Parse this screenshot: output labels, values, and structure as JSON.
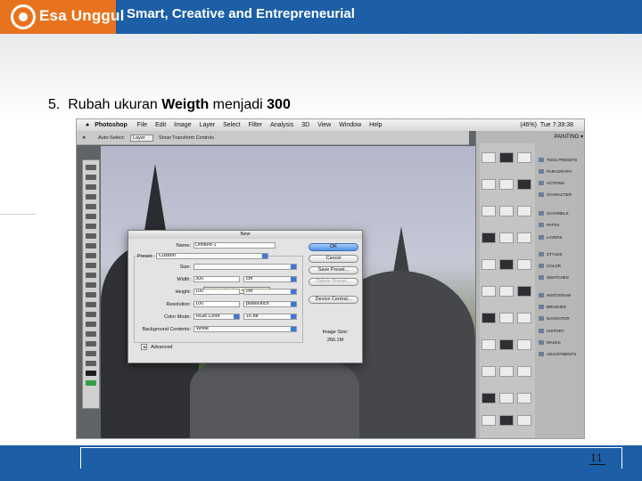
{
  "header": {
    "logo_text": "Esa Unggul",
    "tagline": "Smart, Creative and Entrepreneurial"
  },
  "step": {
    "number": "5.",
    "text_before": "Rubah ukuran ",
    "text_bold1": "Weigth",
    "text_middle": " menjadi ",
    "text_bold2": "300"
  },
  "photoshop": {
    "app": "Photoshop",
    "menus": [
      "File",
      "Edit",
      "Image",
      "Layer",
      "Select",
      "Filter",
      "Analysis",
      "3D",
      "View",
      "Window",
      "Help"
    ],
    "battery": "(46%)",
    "clock": "Tue 7:39:38",
    "workspace": "PAINTING ▾",
    "options": {
      "auto_select": "Auto-Select:",
      "layer": "Layer",
      "show_transform": "Show Transform Controls"
    },
    "panels": [
      "TOOL PRESETS",
      "PARAGRAPH",
      "ACTIONS",
      "CHARACTER",
      "CHANNELS",
      "PATHS",
      "LAYERS",
      "STYLES",
      "COLOR",
      "SWATCHES",
      "HISTOGRAM",
      "BRUSHES",
      "NAVIGATOR",
      "HISTORY",
      "MASKS",
      "ADJUSTMENTS"
    ]
  },
  "dialog": {
    "title": "New",
    "name_label": "Name:",
    "name_value": "Untitled-1",
    "preset_label": "Preset:",
    "preset_value": "Custom",
    "size_label": "Size:",
    "width_label": "Width:",
    "width_value": "300",
    "width_unit": "cm",
    "height_label": "Height:",
    "height_value": "100",
    "height_unit": "cm",
    "resolution_label": "Resolution:",
    "resolution_value": "100",
    "resolution_unit": "pixels/inch",
    "color_mode_label": "Color Mode:",
    "color_mode_value": "RGB Color",
    "bit_value": "16 bit",
    "background_label": "Background Contents:",
    "background_value": "White",
    "advanced_label": "Advanced",
    "tooltip": "Set the width of the new document",
    "ok": "OK",
    "cancel": "Cancel",
    "save_preset": "Save Preset...",
    "delete_preset": "Delete Preset...",
    "device_central": "Device Central...",
    "image_size_label": "Image Size:",
    "image_size_value": "266.1M"
  },
  "footer": {
    "page_number": "11"
  }
}
